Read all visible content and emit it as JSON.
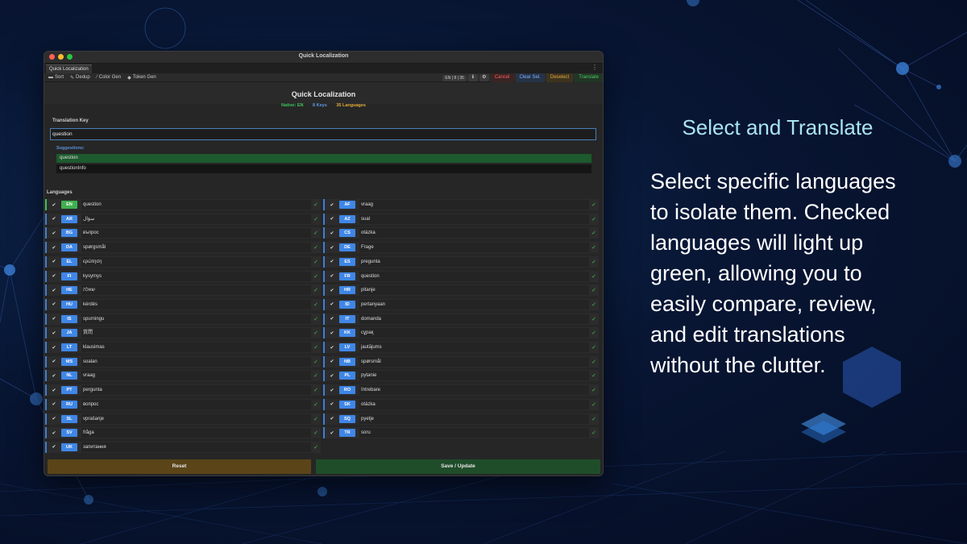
{
  "window": {
    "title": "Quick Localization",
    "tab_label": "Quick Localization",
    "kebab_icon": "⋮"
  },
  "toolbar": {
    "tools": [
      {
        "icon": "folder-icon",
        "glyph": "▬",
        "label": "Sort"
      },
      {
        "icon": "brush-icon",
        "glyph": "✎",
        "label": "Dedup"
      },
      {
        "icon": "wand-icon",
        "glyph": "⁄",
        "label": "Color Gen"
      },
      {
        "icon": "tag-icon",
        "glyph": "◆",
        "label": "Token Gen"
      }
    ],
    "counter": "EN | 8 | 35",
    "info_glyph": "ℹ",
    "settings_glyph": "⚙",
    "actions": [
      {
        "label": "Cancel",
        "color": "#ff5b5b",
        "bg": "#3a2424"
      },
      {
        "label": "Clear Sel.",
        "color": "#7fb2ff",
        "bg": "#263246"
      },
      {
        "label": "Deselect",
        "color": "#e0a93c",
        "bg": "#3d331f"
      },
      {
        "label": "Translate",
        "color": "#49c95e",
        "bg": "#223626"
      }
    ]
  },
  "header": {
    "title": "Quick Localization",
    "native": "Native: EN",
    "keys": "8 Keys",
    "languages": "35 Languages"
  },
  "translation_key": {
    "label": "Translation Key",
    "value": "question",
    "suggestions_label": "Suggestions:",
    "suggestions": [
      "question",
      "questionInfo"
    ]
  },
  "languages": {
    "label": "Languages",
    "left": [
      {
        "code": "EN",
        "value": "question",
        "native": true
      },
      {
        "code": "AR",
        "value": "سؤال"
      },
      {
        "code": "BG",
        "value": "въпрос"
      },
      {
        "code": "DA",
        "value": "spørgsmål"
      },
      {
        "code": "EL",
        "value": "ερώτηση"
      },
      {
        "code": "FI",
        "value": "kysymys"
      },
      {
        "code": "HE",
        "value": "שאלה"
      },
      {
        "code": "HU",
        "value": "kérdés"
      },
      {
        "code": "IS",
        "value": "spurningu"
      },
      {
        "code": "JA",
        "value": "質問"
      },
      {
        "code": "LT",
        "value": "klausimas"
      },
      {
        "code": "MS",
        "value": "soalan"
      },
      {
        "code": "NL",
        "value": "vraag"
      },
      {
        "code": "PT",
        "value": "pergunta"
      },
      {
        "code": "RU",
        "value": "вопрос"
      },
      {
        "code": "SL",
        "value": "vprašanje"
      },
      {
        "code": "SV",
        "value": "fråga"
      },
      {
        "code": "UK",
        "value": "запитання"
      }
    ],
    "right": [
      {
        "code": "AF",
        "value": "vraag"
      },
      {
        "code": "AZ",
        "value": "sual"
      },
      {
        "code": "CS",
        "value": "otázka"
      },
      {
        "code": "DE",
        "value": "Frage"
      },
      {
        "code": "ES",
        "value": "pregunta"
      },
      {
        "code": "FR",
        "value": "question"
      },
      {
        "code": "HR",
        "value": "pitanje"
      },
      {
        "code": "ID",
        "value": "pertanyaan"
      },
      {
        "code": "IT",
        "value": "domanda"
      },
      {
        "code": "KK",
        "value": "сұрақ"
      },
      {
        "code": "LV",
        "value": "jautājums"
      },
      {
        "code": "NB",
        "value": "spørsmål"
      },
      {
        "code": "PL",
        "value": "pytanie"
      },
      {
        "code": "RO",
        "value": "întrebare"
      },
      {
        "code": "SK",
        "value": "otázka"
      },
      {
        "code": "SQ",
        "value": "pyetje"
      },
      {
        "code": "TR",
        "value": "soru"
      }
    ],
    "check_glyph": "✔",
    "ok_glyph": "✓"
  },
  "footer": {
    "reset": "Reset",
    "save": "Save / Update"
  },
  "promo": {
    "title": "Select and Translate",
    "lines": [
      "Select specific languages",
      "to isolate them. Checked",
      "languages will light up",
      "green, allowing you to",
      "easily compare, review,",
      "and edit translations",
      "without the clutter."
    ]
  },
  "colors": {
    "green": "#3fc25a",
    "blue": "#3d7fd9",
    "native_code_bg": "#3fb04f",
    "code_bg": "#3f86e6",
    "orange": "#e0a93c",
    "reset_bg": "#5a4418",
    "save_bg": "#1f4d2a"
  }
}
